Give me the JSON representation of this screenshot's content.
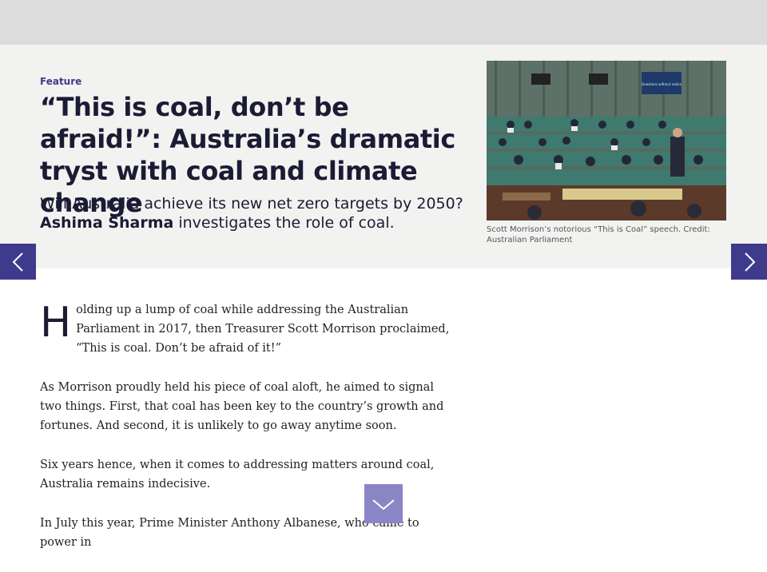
{
  "article": {
    "kicker": "Feature",
    "headline": "“This is coal, don’t be afraid!”: Australia’s dramatic tryst with coal and climate change",
    "standfirst_text": "Will Australia achieve its new net zero targets by 2050?",
    "author": "Ashima Sharma",
    "standfirst_tail": " investigates the role of coal.",
    "image_caption": "Scott Morrison’s notorious “This is Coal” speech. Credit: Australian Parliament",
    "dropcap": "H",
    "paragraph_1_rest": "olding up a lump of coal while addressing the Australian Parliament in 2017, then Treasurer Scott Morrison proclaimed, “This is coal. Don’t be afraid of it!”",
    "paragraph_2": "As Morrison proudly held his piece of coal aloft, he aimed to signal two things. First, that coal has been key to the country’s growth and fortunes. And second, it is unlikely to go away anytime soon.",
    "paragraph_3": "Six years hence, when it comes to addressing matters around coal, Australia remains indecisive.",
    "paragraph_4": "In July this year, Prime Minister Anthony Albanese, who came to power in"
  },
  "photo_screen_text": "Questions without notice",
  "nav": {
    "prev_icon": "chevron-left-icon",
    "next_icon": "chevron-right-icon",
    "scroll_icon": "chevron-down-icon"
  },
  "colors": {
    "accent": "#3e3a8c",
    "hero_bg": "#f2f2f1",
    "topbar_bg": "#dcdcdc",
    "scroll_button": "#8a86c6"
  }
}
